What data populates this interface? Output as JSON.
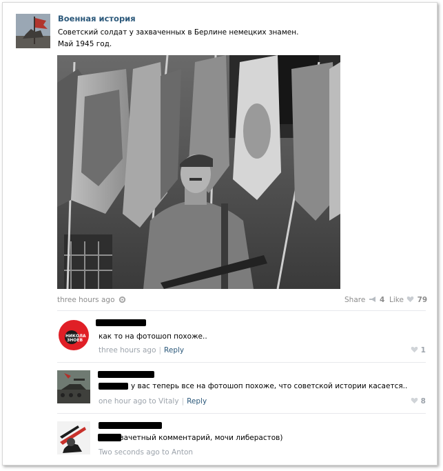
{
  "post": {
    "group_name": "Военная история",
    "text_line1": "Советский солдат у захваченных в Берлине немецких знамен.",
    "text_line2": "Май 1945 год.",
    "time": "three hours ago",
    "share_label": "Share",
    "share_count": "4",
    "like_label": "Like",
    "like_count": "79"
  },
  "comments": [
    {
      "text": "как то на фотошоп похоже..",
      "time": "three hours ago",
      "reply_label": "Reply",
      "likes": "1",
      "avatar_text": "НИКОЛА ЗНОЕВ"
    },
    {
      "text": "у вас теперь все на фотошоп похоже, что советской истории касается..",
      "time": "one hour ago to Vitaly",
      "reply_label": "Reply",
      "likes": "8"
    },
    {
      "text": "зачетный комментарий, мочи либерастов)",
      "time": "Two seconds ago to Anton"
    }
  ],
  "colors": {
    "link": "#2b587a",
    "muted": "#8c8c8c",
    "meta": "#9ca3ab"
  },
  "icons": {
    "gear": "gear-icon",
    "share": "megaphone-icon",
    "like": "heart-icon"
  }
}
